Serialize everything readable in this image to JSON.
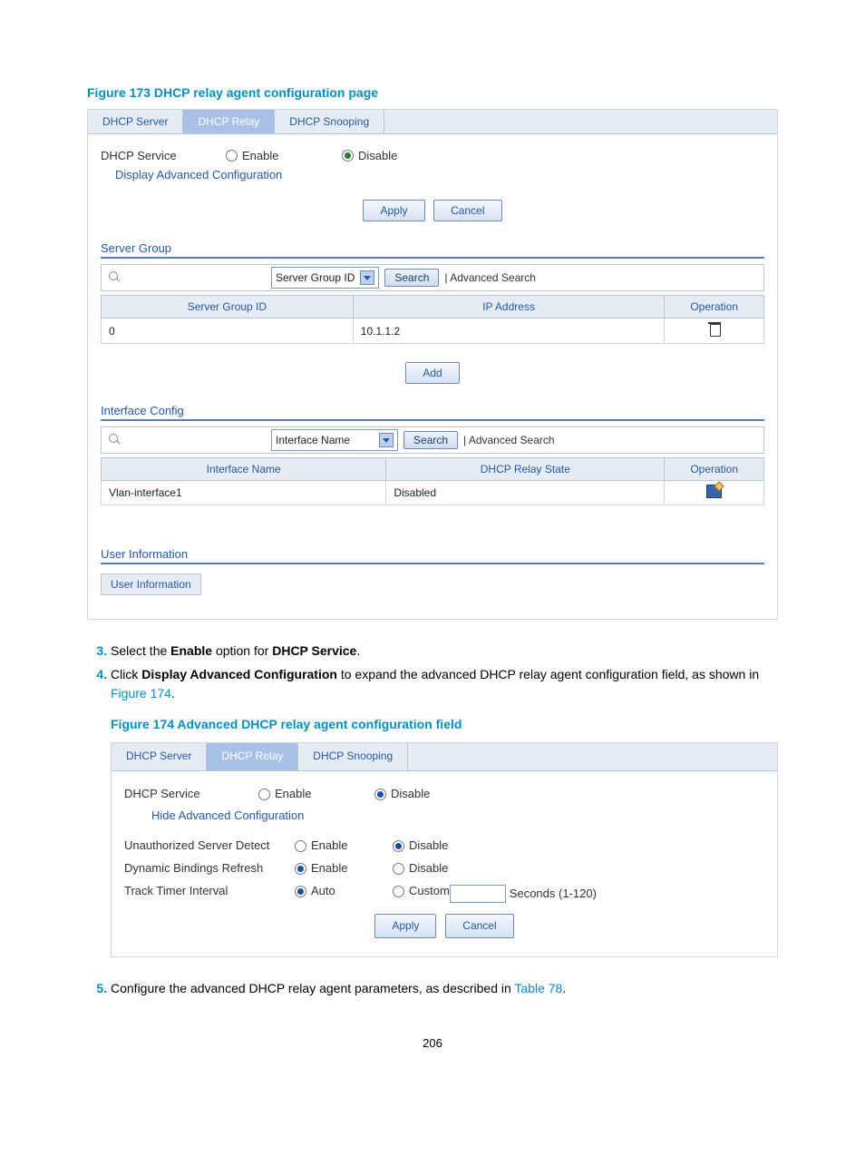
{
  "fig173": {
    "caption": "Figure 173 DHCP relay agent configuration page",
    "tabs": {
      "server": "DHCP Server",
      "relay": "DHCP Relay",
      "snoop": "DHCP Snooping"
    },
    "dhcp_service_label": "DHCP Service",
    "enable": "Enable",
    "disable": "Disable",
    "display_adv": "Display Advanced Configuration",
    "apply": "Apply",
    "cancel": "Cancel",
    "server_group": {
      "title": "Server Group",
      "dd": "Server Group ID",
      "search": "Search",
      "adv": "| Advanced Search",
      "cols": {
        "id": "Server Group ID",
        "ip": "IP Address",
        "op": "Operation"
      },
      "row": {
        "id": "0",
        "ip": "10.1.1.2"
      },
      "add": "Add"
    },
    "iface": {
      "title": "Interface Config",
      "dd": "Interface Name",
      "search": "Search",
      "adv": "| Advanced Search",
      "cols": {
        "name": "Interface Name",
        "state": "DHCP Relay State",
        "op": "Operation"
      },
      "row": {
        "name": "Vlan-interface1",
        "state": "Disabled"
      }
    },
    "userinfo": {
      "title": "User Information",
      "box": "User Information"
    }
  },
  "steps": {
    "s3a": "Select the ",
    "s3b": "Enable",
    "s3c": " option for ",
    "s3d": "DHCP Service",
    "s3e": ".",
    "s4a": "Click ",
    "s4b": "Display Advanced Configuration",
    "s4c": " to expand the advanced DHCP relay agent configuration field, as shown in ",
    "s4d": "Figure 174",
    "s4e": ".",
    "s5a": "Configure the advanced DHCP relay agent parameters, as described in ",
    "s5b": "Table 78",
    "s5c": "."
  },
  "fig174": {
    "caption": "Figure 174 Advanced DHCP relay agent configuration field",
    "tabs": {
      "server": "DHCP Server",
      "relay": "DHCP Relay",
      "snoop": "DHCP Snooping"
    },
    "dhcp_service_label": "DHCP Service",
    "enable": "Enable",
    "disable": "Disable",
    "hide_adv": "Hide Advanced Configuration",
    "unauth": "Unauthorized Server Detect",
    "dynbind": "Dynamic Bindings Refresh",
    "track": "Track Timer Interval",
    "auto": "Auto",
    "custom": "Custom",
    "seconds": "Seconds (1-120)",
    "apply": "Apply",
    "cancel": "Cancel"
  },
  "pageno": "206"
}
